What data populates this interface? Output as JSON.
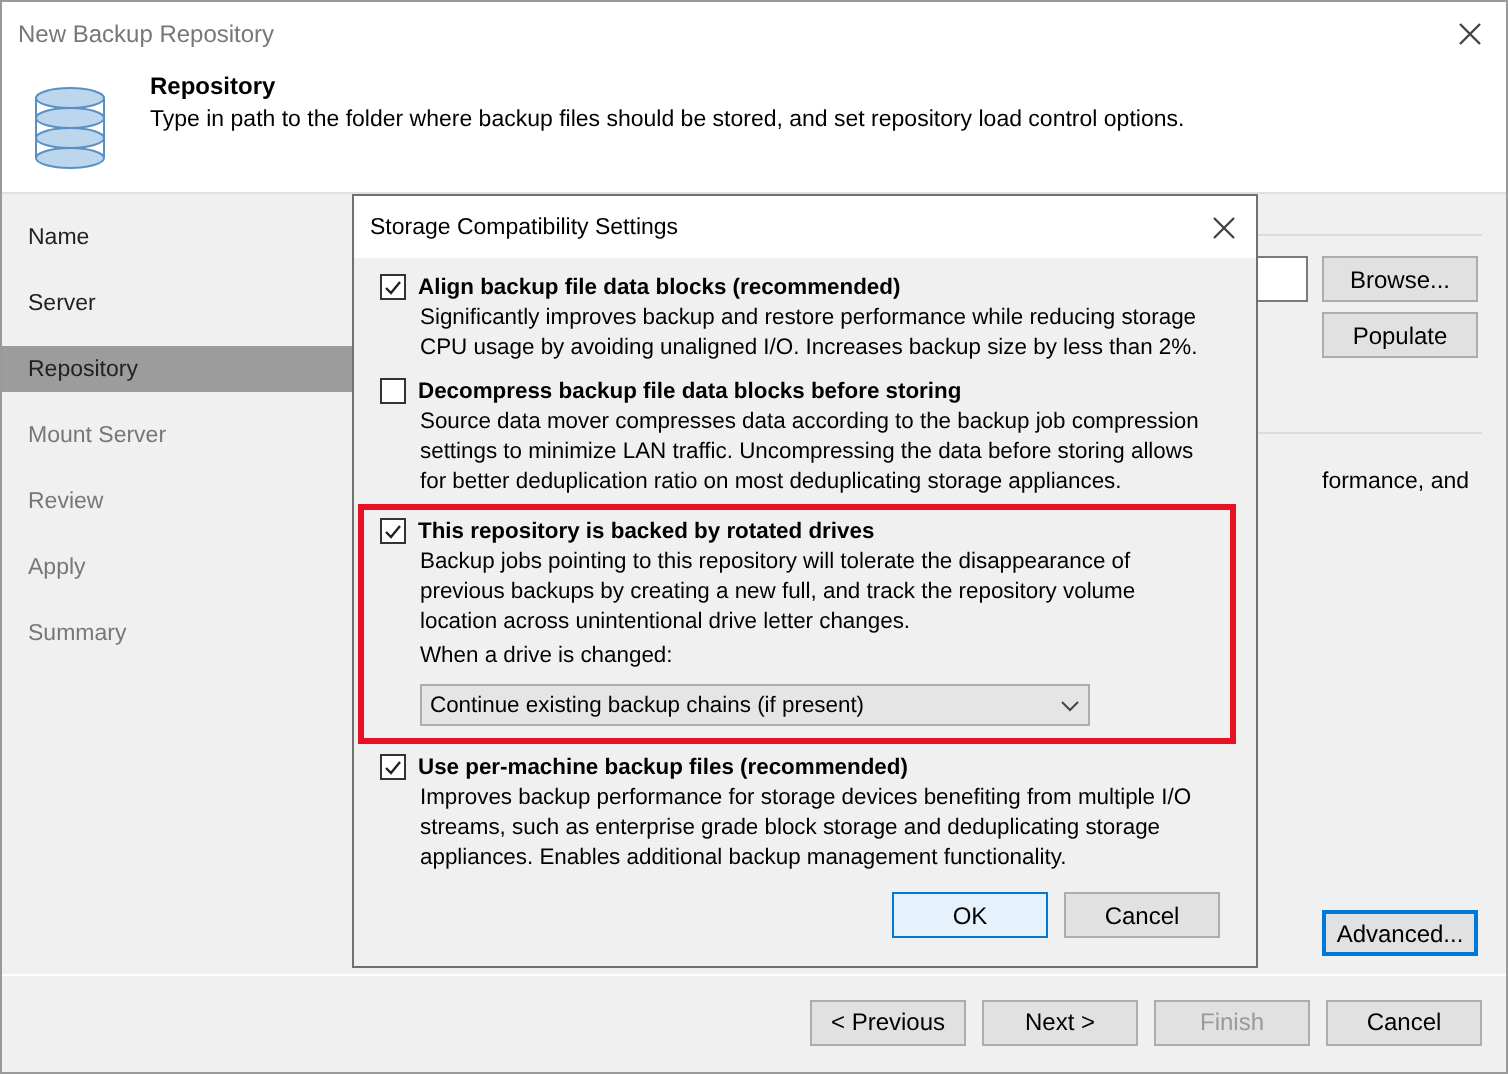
{
  "window": {
    "title": "New Backup Repository"
  },
  "header": {
    "title": "Repository",
    "description": "Type in path to the folder where backup files should be stored, and set repository load control options."
  },
  "steps": [
    {
      "label": "Name",
      "selected": false,
      "disabled": false
    },
    {
      "label": "Server",
      "selected": false,
      "disabled": false
    },
    {
      "label": "Repository",
      "selected": true,
      "disabled": false
    },
    {
      "label": "Mount Server",
      "selected": false,
      "disabled": true
    },
    {
      "label": "Review",
      "selected": false,
      "disabled": true
    },
    {
      "label": "Apply",
      "selected": false,
      "disabled": true
    },
    {
      "label": "Summary",
      "selected": false,
      "disabled": true
    }
  ],
  "page": {
    "buttons": [
      {
        "label": "Browse..."
      },
      {
        "label": "Populate"
      }
    ],
    "partial_text": "formance, and",
    "advanced_button": {
      "label": "Advanced...",
      "focused": true
    }
  },
  "footer": {
    "buttons": [
      {
        "label": "< Previous",
        "disabled": false
      },
      {
        "label": "Next >",
        "disabled": false
      },
      {
        "label": "Finish",
        "disabled": true
      },
      {
        "label": "Cancel",
        "disabled": false
      }
    ]
  },
  "dialog": {
    "title": "Storage Compatibility Settings",
    "options": [
      {
        "label": "Align backup file data blocks (recommended)",
        "description": "Significantly improves backup and restore performance while reducing storage CPU usage by avoiding unaligned I/O. Increases backup size by less than 2%.",
        "checked": true,
        "highlighted": false
      },
      {
        "label": "Decompress backup file data blocks before storing",
        "description": "Source data mover compresses data according to the backup job compression settings to minimize LAN traffic. Uncompressing the data before storing allows for better deduplication ratio on most deduplicating storage appliances.",
        "checked": false,
        "highlighted": false
      },
      {
        "label": "This repository is backed by rotated drives",
        "description": "Backup jobs pointing to this repository will tolerate the disappearance of previous backups by creating a new full, and track the repository volume location across unintentional drive letter changes.",
        "checked": true,
        "highlighted": true,
        "dropdown_label": "When a drive is changed:",
        "dropdown_value": "Continue existing backup chains (if present)"
      },
      {
        "label": "Use per-machine backup files (recommended)",
        "description": "Improves backup performance for storage devices benefiting from multiple I/O streams, such as enterprise grade block storage and deduplicating storage appliances. Enables additional backup management functionality.",
        "checked": true,
        "highlighted": false
      }
    ],
    "buttons": [
      {
        "label": "OK",
        "default": true
      },
      {
        "label": "Cancel",
        "default": false
      }
    ]
  }
}
